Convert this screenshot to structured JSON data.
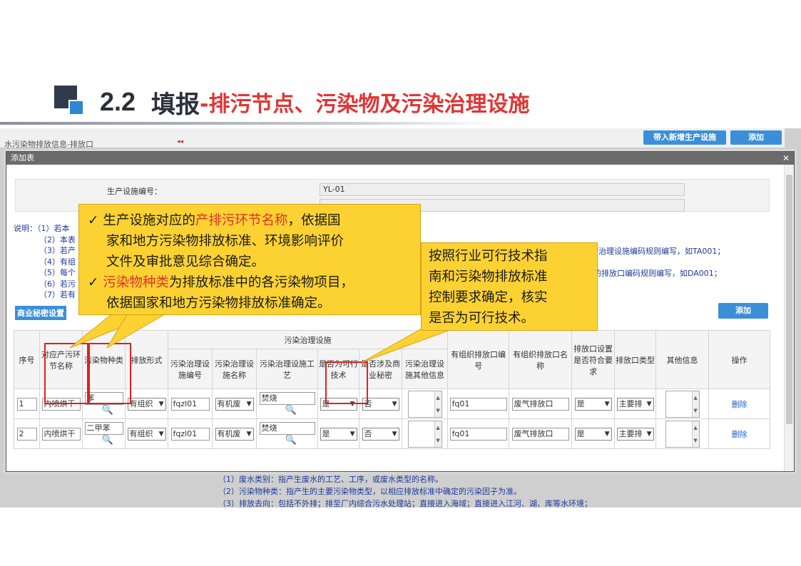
{
  "slide": {
    "number": "2.2",
    "title_main": "填报",
    "title_sub": "-排污节点、污染物及污染治理设施"
  },
  "background_page": {
    "tab_label": "水污染物排放信息-排放口",
    "collapse_glyph": "◂◂",
    "buttons": [
      "带入新增生产设施",
      "添加"
    ],
    "notes": [
      "（1）废水类别：指产生废水的工艺、工序，或废水类型的名称。",
      "（2）污染物种类：指产生的主要污染物类型，以相应排放标准中确定的污染因子为准。",
      "（3）排放去向：包括不外排；排至厂内综合污水处理站；直接进入海域；直接进入江河、湖、库等水环境；"
    ]
  },
  "dialog": {
    "title": "添加表",
    "close_glyph": "✕",
    "fields": [
      {
        "label": "生产设施编号：",
        "value": "YL-01"
      }
    ],
    "notes": [
      "说明：（1）若本",
      "（2）本表",
      "（3）若产",
      "（4）有组",
      "（5）每个",
      "（6）若污",
      "（7）若有"
    ],
    "notes_right": [
      "中的治理设施编码规则编写，如TA001；",
      "中的排放口编码规则编写，如DA001；"
    ],
    "commercial_secret_link": "商业秘密设置",
    "add_button": "添加",
    "table": {
      "group_header": "污染治理设施",
      "headers": {
        "seq": "序号",
        "node": "对应产污环节名称",
        "pollutant": "污染物种类",
        "emission_form": "排放形式",
        "facility_code": "污染治理设施编号",
        "facility_name": "污染治理设施名称",
        "process": "污染治理设施工艺",
        "feasible": "是否为可行技术",
        "secret": "是否涉及商业秘密",
        "other_info": "污染治理设施其他信息",
        "outlet_code": "有组织排放口编号",
        "outlet_name": "有组织排放口名称",
        "outlet_req": "排放口设置是否符合要求",
        "outlet_type": "排放口类型",
        "extra": "其他信息",
        "ops": "操作"
      },
      "rows": [
        {
          "seq": "1",
          "node": "内喷烘干",
          "pollutant": "苯",
          "emission_form": "有组织",
          "facility_code": "fqzl01",
          "facility_name": "有机废",
          "process": "焚烧",
          "feasible": "是",
          "secret": "否",
          "outlet_code": "fq01",
          "outlet_name": "废气排放口",
          "outlet_req": "是",
          "outlet_type": "主要排",
          "action": "删除"
        },
        {
          "seq": "2",
          "node": "内喷烘干",
          "pollutant": "二甲苯",
          "emission_form": "有组织",
          "facility_code": "fqzl01",
          "facility_name": "有机废",
          "process": "焚烧",
          "feasible": "是",
          "secret": "否",
          "outlet_code": "fq01",
          "outlet_name": "废气排放口",
          "outlet_req": "是",
          "outlet_type": "主要排",
          "action": "删除"
        }
      ]
    }
  },
  "callout_left": {
    "check": "✓",
    "line1_a": "生产设施对应的",
    "line1_red": "产排污环节名称",
    "line1_b": "，依据国",
    "line2": "家和地方污染物排放标准、环境影响评价",
    "line3": "文件及审批意见综合确定。",
    "line4_red": "污染物种类",
    "line4_b": "为排放标准中的各污染物项目，",
    "line5": "依据国家和地方污染物排放标准确定。"
  },
  "callout_right": {
    "line1": "按照行业可行技术指",
    "line2": "南和污染物排放标准",
    "line3": "控制要求确定，核实",
    "line4": "是否为可行技术。"
  },
  "colors": {
    "accent_red": "#e03535",
    "callout_yellow": "#fcd232",
    "button_blue": "#3b8fd8",
    "note_blue": "#1f3a9a"
  }
}
